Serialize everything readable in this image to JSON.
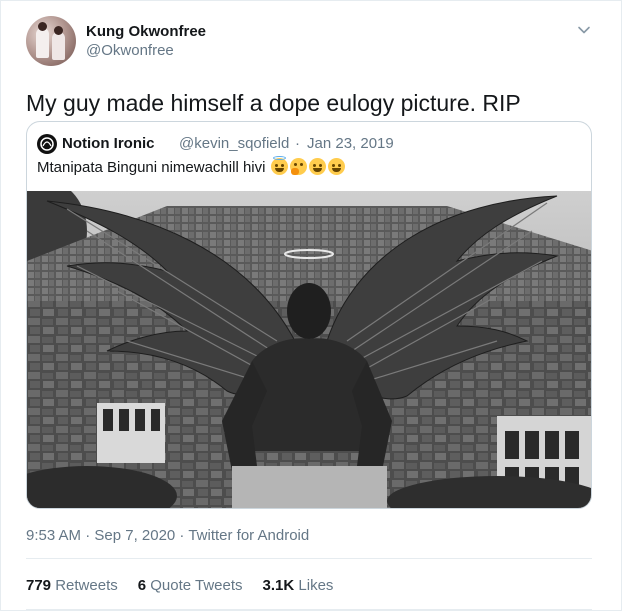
{
  "tweet": {
    "author": {
      "display_name": "Kung Okwonfree",
      "handle": "@Okwonfree"
    },
    "text": "My guy made himself a dope eulogy picture. RIP",
    "menu_icon": "chevron-down-icon"
  },
  "quoted_tweet": {
    "author": {
      "display_name": "Notion Ironic",
      "handle": "@kevin_sqofield"
    },
    "separator": "·",
    "date": "Jan 23, 2019",
    "text": "Mtanipata Binguni nimewachill hivi",
    "emojis": [
      "smiling-face-with-halo",
      "thinking-face",
      "grinning-face",
      "grinning-face"
    ]
  },
  "meta": {
    "timestamp": "9:53 AM · Sep 7, 2020 · Twitter for Android"
  },
  "stats": {
    "retweets_count": "779",
    "retweets_label": "Retweets",
    "quote_tweets_count": "6",
    "quote_tweets_label": "Quote Tweets",
    "likes_count": "3.1K",
    "likes_label": "Likes"
  },
  "colors": {
    "primary_text": "#14171a",
    "secondary_text": "#657786",
    "border": "#ccd6dd",
    "divider": "#e6ecf0"
  }
}
